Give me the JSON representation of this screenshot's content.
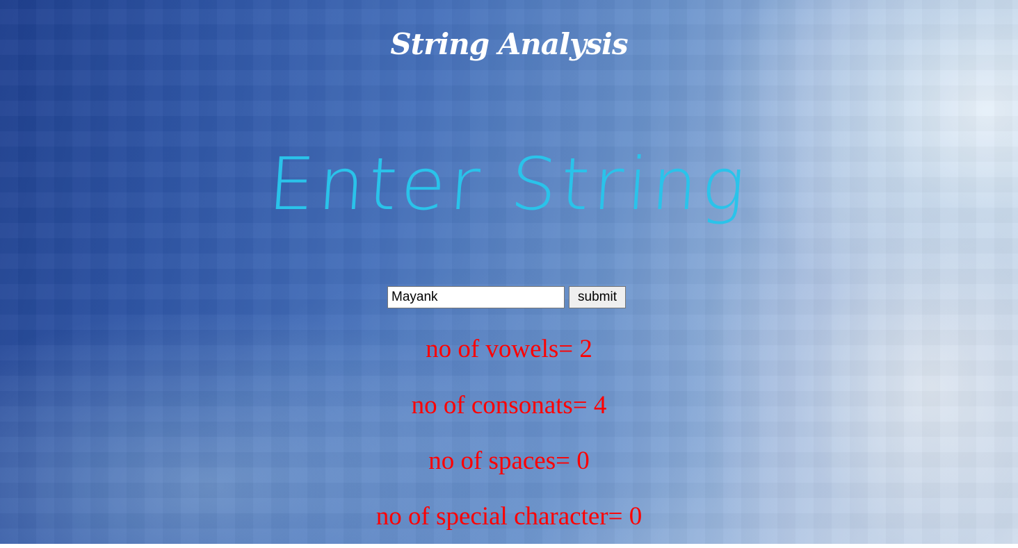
{
  "header": {
    "title": "String Analysis"
  },
  "main": {
    "prompt": "Enter String",
    "input": {
      "value": "Mayank"
    },
    "submit_label": "submit",
    "results": {
      "vowels": "no of vowels= 2",
      "consonants": "no of consonats= 4",
      "spaces": "no of spaces= 0",
      "special": "no of special character= 0"
    }
  },
  "colors": {
    "title": "#ffffff",
    "prompt": "#2ac3ea",
    "results": "#ff0000"
  }
}
